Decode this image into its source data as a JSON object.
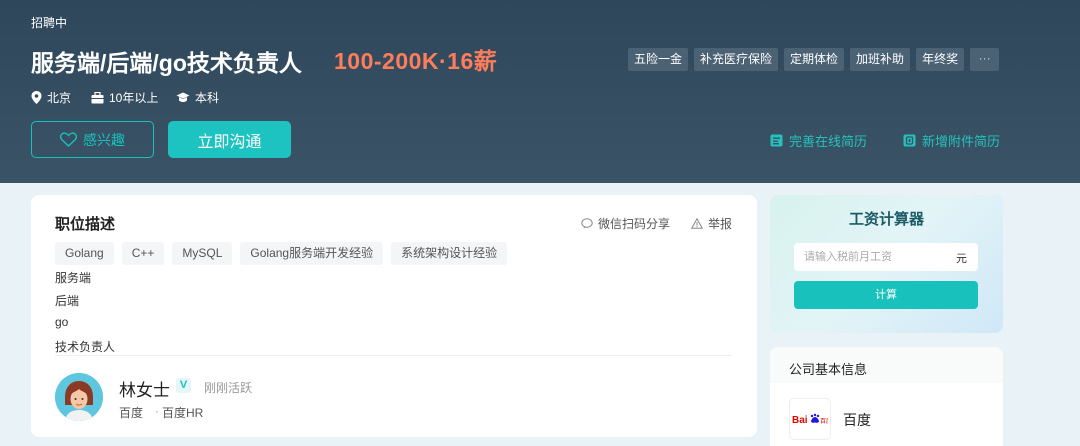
{
  "job": {
    "status": "招聘中",
    "title": "服务端/后端/go技术负责人",
    "salary": "100-200K·16薪",
    "location": "北京",
    "experience": "10年以上",
    "education": "本科"
  },
  "benefits": [
    "五险一金",
    "补充医疗保险",
    "定期体检",
    "加班补助",
    "年终奖"
  ],
  "benefits_more": "···",
  "actions": {
    "interest": "感兴趣",
    "chat": "立即沟通",
    "improve_resume": "完善在线简历",
    "add_attachment": "新增附件简历"
  },
  "description": {
    "title": "职位描述",
    "share": "微信扫码分享",
    "report": "举报",
    "skills": [
      "Golang",
      "C++",
      "MySQL",
      "Golang服务端开发经验",
      "系统架构设计经验"
    ],
    "lines": [
      "服务端",
      "后端",
      "go",
      "技术负责人"
    ]
  },
  "recruiter": {
    "name": "林女士",
    "verified_mark": "V",
    "active": "刚刚活跃",
    "company": "百度",
    "separator": "·",
    "role": "百度HR"
  },
  "calculator": {
    "title": "工资计算器",
    "placeholder": "请输入税前月工资",
    "unit": "元",
    "button": "计算"
  },
  "company": {
    "section_title": "公司基本信息",
    "name": "百度",
    "logo_text": "Bai百度"
  },
  "colors": {
    "hero_bg": "#324a5e",
    "accent": "#1cc3c0",
    "salary": "#ff7d5a"
  }
}
